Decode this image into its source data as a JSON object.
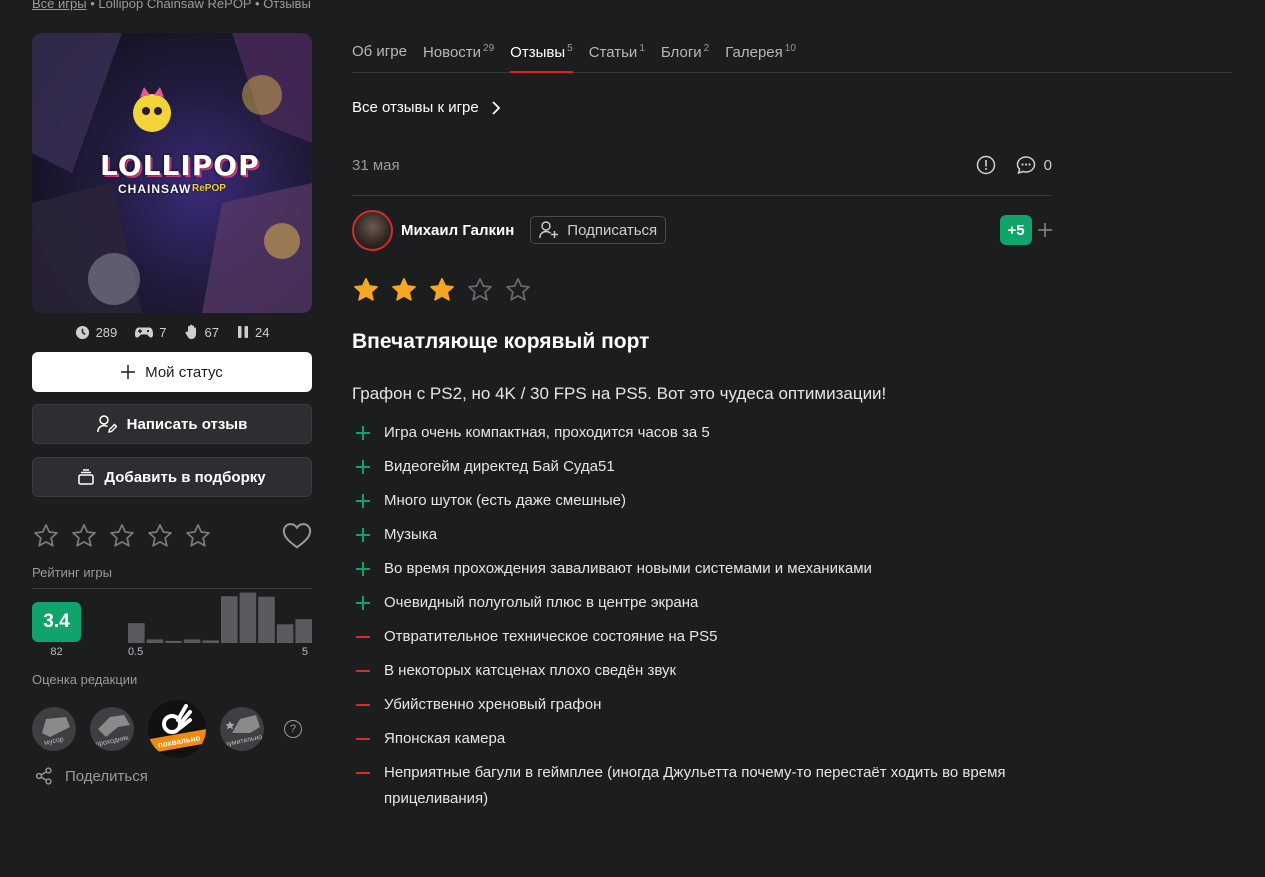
{
  "breadcrumbs": {
    "root": "Все игры",
    "separator": "•",
    "game": "Lollipop Chainsaw RePOP",
    "current": "Отзывы"
  },
  "game": {
    "cover_logo_text": "LOLLIPOP",
    "cover_subtitle": "CHAINSAW",
    "cover_subtitle2": "RePOP",
    "stats": [
      {
        "icon": "clock-icon",
        "value": "289"
      },
      {
        "icon": "gamepad-icon",
        "value": "7"
      },
      {
        "icon": "hand-icon",
        "value": "67"
      },
      {
        "icon": "pause-icon",
        "value": "24"
      }
    ]
  },
  "actions": {
    "my_status": "Мой статус",
    "write_review": "Написать отзыв",
    "add_to_collection": "Добавить в подборку"
  },
  "user_rating": {
    "stars": 0,
    "max": 5
  },
  "game_rating": {
    "label": "Рейтинг игры",
    "score": "3.4",
    "count": "82",
    "hist_min": "0.5",
    "hist_max": "5",
    "histogram": [
      0.38,
      0.07,
      0.04,
      0.07,
      0.05,
      0.9,
      0.97,
      0.89,
      0.36,
      0.46
    ]
  },
  "editorial": {
    "label": "Оценка редакции",
    "badges": [
      "мусор",
      "проходняк",
      "похвально",
      "изумительно"
    ],
    "selected": "похвально",
    "help": "?"
  },
  "share_label": "Поделиться",
  "tabs": [
    {
      "label": "Об игре",
      "count": ""
    },
    {
      "label": "Новости",
      "count": "29"
    },
    {
      "label": "Отзывы",
      "count": "5",
      "active": true
    },
    {
      "label": "Статьи",
      "count": "1"
    },
    {
      "label": "Блоги",
      "count": "2"
    },
    {
      "label": "Галерея",
      "count": "10"
    }
  ],
  "all_reviews_link": "Все отзывы к игре",
  "review": {
    "date": "31 мая",
    "comments": "0",
    "author": "Михаил Галкин",
    "follow_label": "Подписаться",
    "karma": "+5",
    "stars": 3,
    "max_stars": 5,
    "title": "Впечатляюще корявый порт",
    "text": "Графон с PS2, но 4K / 30 FPS на PS5. Вот это чудеса оптимизации!",
    "pros": [
      "Игра очень компактная, проходится часов за 5",
      "Видеогейм директед Бай Суда51",
      "Много шуток (есть даже смешные)",
      "Музыка",
      "Во время прохождения заваливают новыми системами и механиками",
      "Очевидный полуголый плюс в центре экрана"
    ],
    "cons": [
      "Отвратительное техническое состояние на PS5",
      "В некоторых катсценах плохо сведён звук",
      "Убийственно хреновый графон",
      "Японская камера",
      "Неприятные багули в геймплее (иногда Джульетта почему-то перестаёт ходить во время прицеливания)"
    ]
  },
  "colors": {
    "accent_green": "#10a36b",
    "accent_red": "#d22c2c",
    "tab_underline": "#e01f2a",
    "star_filled": "#f5a623",
    "badge_orange": "#f08a10"
  }
}
